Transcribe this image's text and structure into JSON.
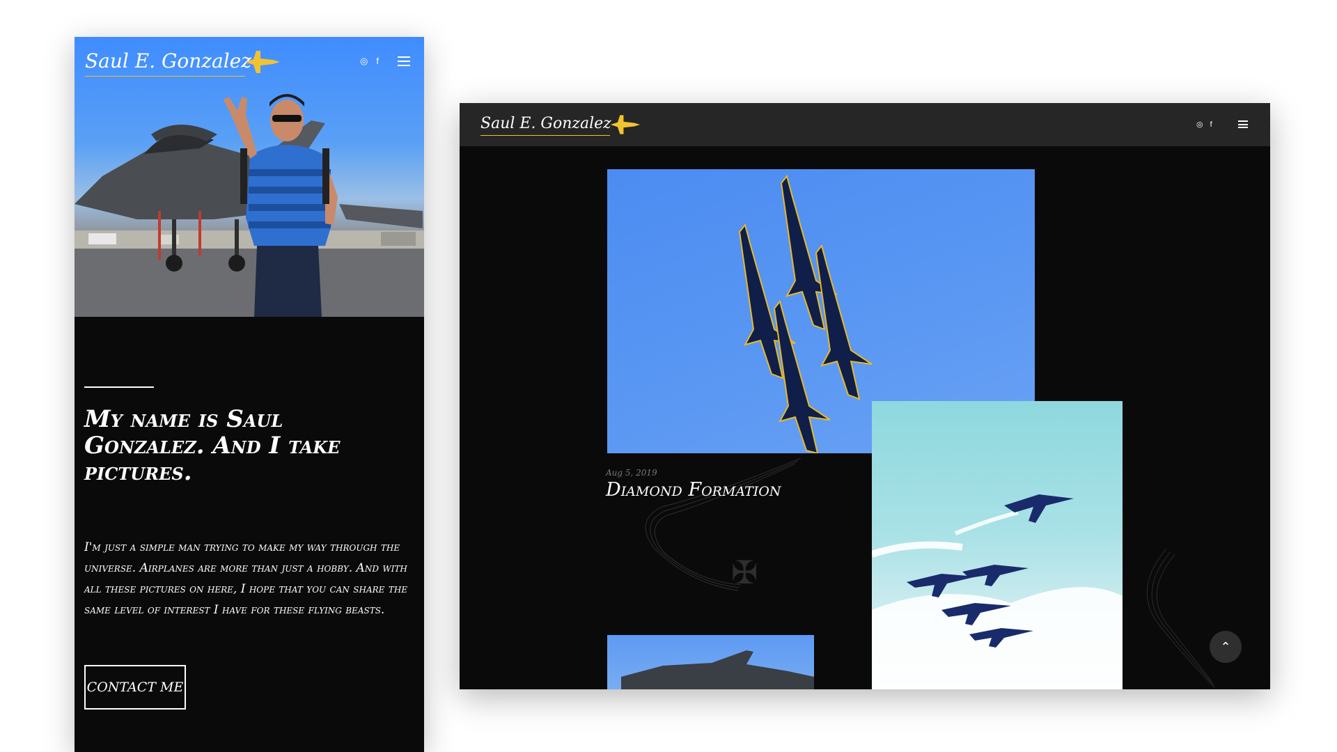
{
  "brand": {
    "name": "Saul E. Gonzalez",
    "accent_color": "#f2c230",
    "logo_icon": "jet-icon"
  },
  "social": {
    "instagram_icon": "instagram-icon",
    "facebook_icon": "facebook-icon",
    "instagram_glyph": "◎",
    "facebook_glyph": "f"
  },
  "menu": {
    "icon": "hamburger-menu-icon"
  },
  "mobile": {
    "headline": "My name is Saul Gonzalez. And I take pictures.",
    "bio": "I'm just a simple man trying to make my way through the universe. Airplanes are more than just a hobby. And with all these pictures on here, I hope that you can share the same level of interest I have for these flying beasts.",
    "contact_button": "Contact me"
  },
  "desktop": {
    "post": {
      "date": "Aug 5, 2019",
      "title": "Diamond Formation"
    },
    "scroll_top_glyph": "⌃"
  },
  "colors": {
    "page_background": "#ffffff",
    "site_background": "#0a0a0a",
    "header_bar": "#262626"
  }
}
